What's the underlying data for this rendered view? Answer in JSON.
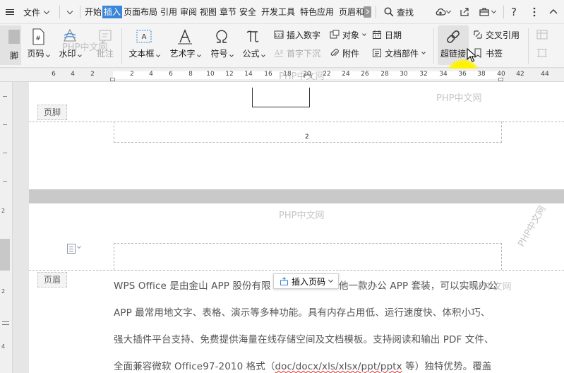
{
  "menubar": {
    "file_label": "文件",
    "tabs": [
      {
        "label": "开始",
        "active": false
      },
      {
        "label": "插入",
        "active": true
      },
      {
        "label": "页面布局",
        "active": false
      },
      {
        "label": "引用",
        "active": false
      },
      {
        "label": "审阅",
        "active": false
      },
      {
        "label": "视图",
        "active": false
      },
      {
        "label": "章节",
        "active": false
      },
      {
        "label": "安全",
        "active": false
      },
      {
        "label": "开发工具",
        "active": false
      },
      {
        "label": "特色应用",
        "active": false
      },
      {
        "label": "页眉和",
        "active": false
      }
    ],
    "search_label": "查找",
    "help_label": "?"
  },
  "ribbon": {
    "partial_label": "脚",
    "page_number": "页码",
    "watermark": "水印",
    "annotation": "批注",
    "textbox": "文本框",
    "art_text": "艺术字",
    "symbol": "符号",
    "formula": "公式",
    "insert_number": "插入数字",
    "object": "对象",
    "date": "日期",
    "drop_cap": "首字下沉",
    "attachment": "附件",
    "doc_parts": "文档部件",
    "hyperlink": "超链接",
    "cross_ref": "交叉引用",
    "bookmark": "书签"
  },
  "ruler": {
    "numbers": [
      "6",
      "4",
      "2",
      "2",
      "4",
      "6",
      "8",
      "10",
      "12",
      "14",
      "16",
      "18",
      "20",
      "22",
      "24",
      "26",
      "28",
      "30",
      "32",
      "34",
      "36",
      "38",
      "40",
      "42",
      "44"
    ],
    "vnumbers": [
      "2",
      "2",
      "4"
    ]
  },
  "document": {
    "footer_tag": "页脚",
    "footer_page_number": "2",
    "header_tag": "页眉",
    "insert_page_number_button": "插入页码",
    "paragraph_lines": [
      [
        "WPS Office 是由金山 APP 股份有限",
        "他一款办公 APP 套装，可以实现办公"
      ],
      [
        "APP 最常用地文字、表格、演示等多种功能。具有内存占用低、运行速度快、体积小巧、"
      ],
      [
        "强大插件平台支持、免费提供海量在线存储空间及文档模板。支持阅读和输出 PDF 文件、"
      ],
      [
        "全面兼容微软 Office97-2010 格式（",
        "doc/docx/xls/xlsx/ppt/pptx",
        " 等）独特优势。覆盖"
      ]
    ]
  },
  "watermarks": [
    "PHP中文网",
    "PHP中文网",
    "PHP中文网",
    "PHP中文网",
    "PHP中文网",
    "PHP中文网"
  ],
  "colors": {
    "accent": "#3a86d8",
    "cursor_highlight": "#fff200"
  }
}
